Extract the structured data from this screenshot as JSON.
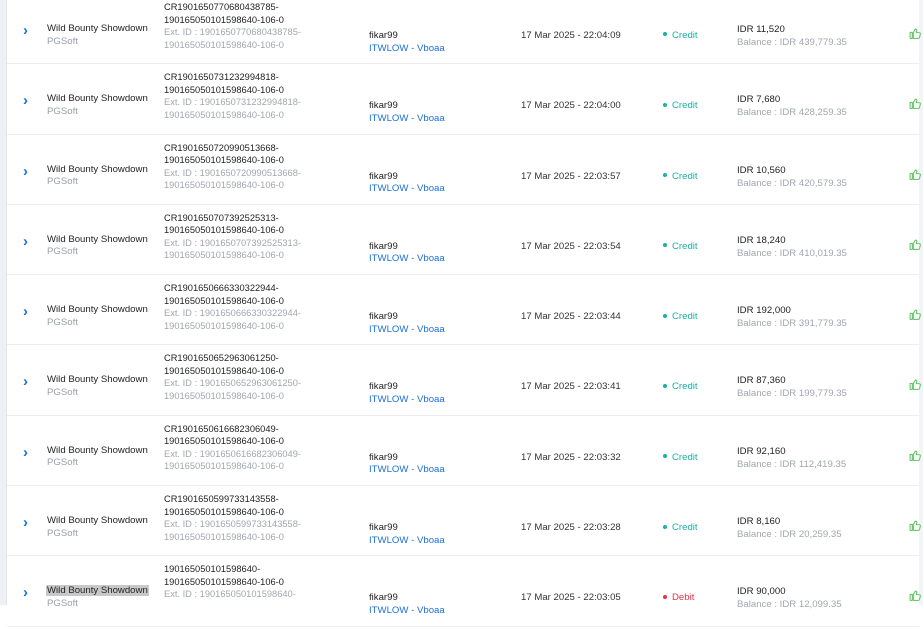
{
  "table": {
    "rows": [
      {
        "game": "Wild Bounty Showdown",
        "provider": "PGSoft",
        "tx_id": "CR1901650770680438785-190165050101598640-106-0",
        "ext_id": "Ext. ID : 1901650770680438785-190165050101598640-106-0",
        "username": "fikar99",
        "account": "ITWLOW - Vboaa",
        "date": "17 Mar 2025 - 22:04:09",
        "type": "Credit",
        "type_color": "#17b3a3",
        "amount": "IDR 11,520",
        "balance": "Balance : IDR 439,779.35",
        "selected": false
      },
      {
        "game": "Wild Bounty Showdown",
        "provider": "PGSoft",
        "tx_id": "CR1901650731232994818-190165050101598640-106-0",
        "ext_id": "Ext. ID : 1901650731232994818-190165050101598640-106-0",
        "username": "fikar99",
        "account": "ITWLOW - Vboaa",
        "date": "17 Mar 2025 - 22:04:00",
        "type": "Credit",
        "type_color": "#17b3a3",
        "amount": "IDR 7,680",
        "balance": "Balance : IDR 428,259.35",
        "selected": false
      },
      {
        "game": "Wild Bounty Showdown",
        "provider": "PGSoft",
        "tx_id": "CR1901650720990513668-190165050101598640-106-0",
        "ext_id": "Ext. ID : 1901650720990513668-190165050101598640-106-0",
        "username": "fikar99",
        "account": "ITWLOW - Vboaa",
        "date": "17 Mar 2025 - 22:03:57",
        "type": "Credit",
        "type_color": "#17b3a3",
        "amount": "IDR 10,560",
        "balance": "Balance : IDR 420,579.35",
        "selected": false
      },
      {
        "game": "Wild Bounty Showdown",
        "provider": "PGSoft",
        "tx_id": "CR1901650707392525313-190165050101598640-106-0",
        "ext_id": "Ext. ID : 1901650707392525313-190165050101598640-106-0",
        "username": "fikar99",
        "account": "ITWLOW - Vboaa",
        "date": "17 Mar 2025 - 22:03:54",
        "type": "Credit",
        "type_color": "#17b3a3",
        "amount": "IDR 18,240",
        "balance": "Balance : IDR 410,019.35",
        "selected": false
      },
      {
        "game": "Wild Bounty Showdown",
        "provider": "PGSoft",
        "tx_id": "CR1901650666330322944-190165050101598640-106-0",
        "ext_id": "Ext. ID : 1901650666330322944-190165050101598640-106-0",
        "username": "fikar99",
        "account": "ITWLOW - Vboaa",
        "date": "17 Mar 2025 - 22:03:44",
        "type": "Credit",
        "type_color": "#17b3a3",
        "amount": "IDR 192,000",
        "balance": "Balance : IDR 391,779.35",
        "selected": false
      },
      {
        "game": "Wild Bounty Showdown",
        "provider": "PGSoft",
        "tx_id": "CR1901650652963061250-190165050101598640-106-0",
        "ext_id": "Ext. ID : 1901650652963061250-190165050101598640-106-0",
        "username": "fikar99",
        "account": "ITWLOW - Vboaa",
        "date": "17 Mar 2025 - 22:03:41",
        "type": "Credit",
        "type_color": "#17b3a3",
        "amount": "IDR 87,360",
        "balance": "Balance : IDR 199,779.35",
        "selected": false
      },
      {
        "game": "Wild Bounty Showdown",
        "provider": "PGSoft",
        "tx_id": "CR1901650616682306049-190165050101598640-106-0",
        "ext_id": "Ext. ID : 1901650616682306049-190165050101598640-106-0",
        "username": "fikar99",
        "account": "ITWLOW - Vboaa",
        "date": "17 Mar 2025 - 22:03:32",
        "type": "Credit",
        "type_color": "#17b3a3",
        "amount": "IDR 92,160",
        "balance": "Balance : IDR 112,419.35",
        "selected": false
      },
      {
        "game": "Wild Bounty Showdown",
        "provider": "PGSoft",
        "tx_id": "CR1901650599733143558-190165050101598640-106-0",
        "ext_id": "Ext. ID : 1901650599733143558-190165050101598640-106-0",
        "username": "fikar99",
        "account": "ITWLOW - Vboaa",
        "date": "17 Mar 2025 - 22:03:28",
        "type": "Credit",
        "type_color": "#17b3a3",
        "amount": "IDR 8,160",
        "balance": "Balance : IDR 20,259.35",
        "selected": false
      },
      {
        "game": "Wild Bounty Showdown",
        "provider": "PGSoft",
        "tx_id": "190165050101598640-190165050101598640-106-0",
        "ext_id": "Ext. ID : 190165050101598640-",
        "username": "fikar99",
        "account": "ITWLOW - Vboaa",
        "date": "17 Mar 2025 - 22:03:05",
        "type": "Debit",
        "type_color": "#e5344b",
        "amount": "IDR 90,000",
        "balance": "Balance : IDR 12,099.35",
        "selected": true
      }
    ],
    "icons": {
      "expand": "chevron-right-icon",
      "action": "thumbs-up-icon"
    },
    "colors": {
      "accent": "#1e6fd6",
      "thumb": "#58c25a"
    }
  }
}
